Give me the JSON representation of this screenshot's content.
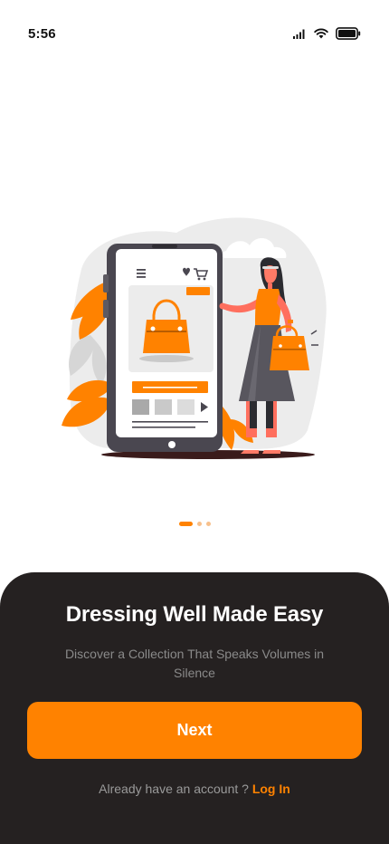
{
  "status_bar": {
    "time": "5:56",
    "icons": [
      "cellular-signal-icon",
      "wifi-icon",
      "battery-icon"
    ]
  },
  "illustration": {
    "icon": "online-shopping-illustration",
    "colors": {
      "accent": "#ff8200",
      "phone_body": "#4a4750",
      "blob": "#ececec"
    }
  },
  "pager": {
    "total": 3,
    "active_index": 0
  },
  "onboarding": {
    "title": "Dressing Well Made Easy",
    "subtitle": "Discover a Collection That Speaks Volumes in Silence",
    "next_label": "Next",
    "login_prompt": "Already have an account ?",
    "login_link": "Log In"
  },
  "colors": {
    "accent": "#ff8200",
    "sheet_background": "#252121",
    "title_text": "#ffffff",
    "muted_text": "#8a8a8a"
  }
}
